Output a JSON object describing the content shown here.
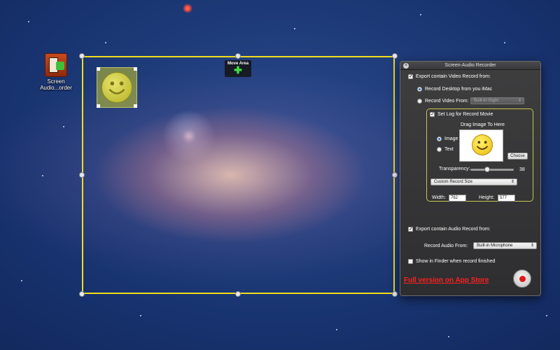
{
  "desktop": {
    "icon_label": "Screen Audio...order"
  },
  "move_area": {
    "label": "Move Area",
    "icon": "plus-icon"
  },
  "panel": {
    "title": "Screen-Audio Recorder",
    "export_video": {
      "label": "Export contain Video Record from:",
      "checked": true
    },
    "record_desktop": {
      "label": "Record Desktop from you iMac",
      "selected": true
    },
    "record_video_from": {
      "label": "Record Video From:",
      "selected": false,
      "value": "Built-in iSight"
    },
    "set_logo": {
      "label": "Set Log for Record Movie",
      "checked": true
    },
    "drag_image_label": "Drag Image To Here",
    "logo_type": {
      "image_label": "Image",
      "text_label": "Text",
      "selected": "Image"
    },
    "choose_button": "Choose",
    "transparency": {
      "label": "Transparency:",
      "value": "38",
      "fraction": 0.38
    },
    "record_size": {
      "value": "Custom Record Size"
    },
    "width": {
      "label": "Width:",
      "value": "762"
    },
    "height": {
      "label": "Height:",
      "value": "577"
    },
    "export_audio": {
      "label": "Export contain Audio Record from:",
      "checked": true
    },
    "record_audio_from": {
      "label": "Record Audio From:",
      "value": "Built-in Microphone"
    },
    "show_in_finder": {
      "label": "Show in Finder when record finished",
      "checked": false
    },
    "full_version_link": "Full version on App Store"
  },
  "colors": {
    "selection_border": "#f2dc1b",
    "link_red": "#ff2020",
    "record_red": "#e01818"
  }
}
